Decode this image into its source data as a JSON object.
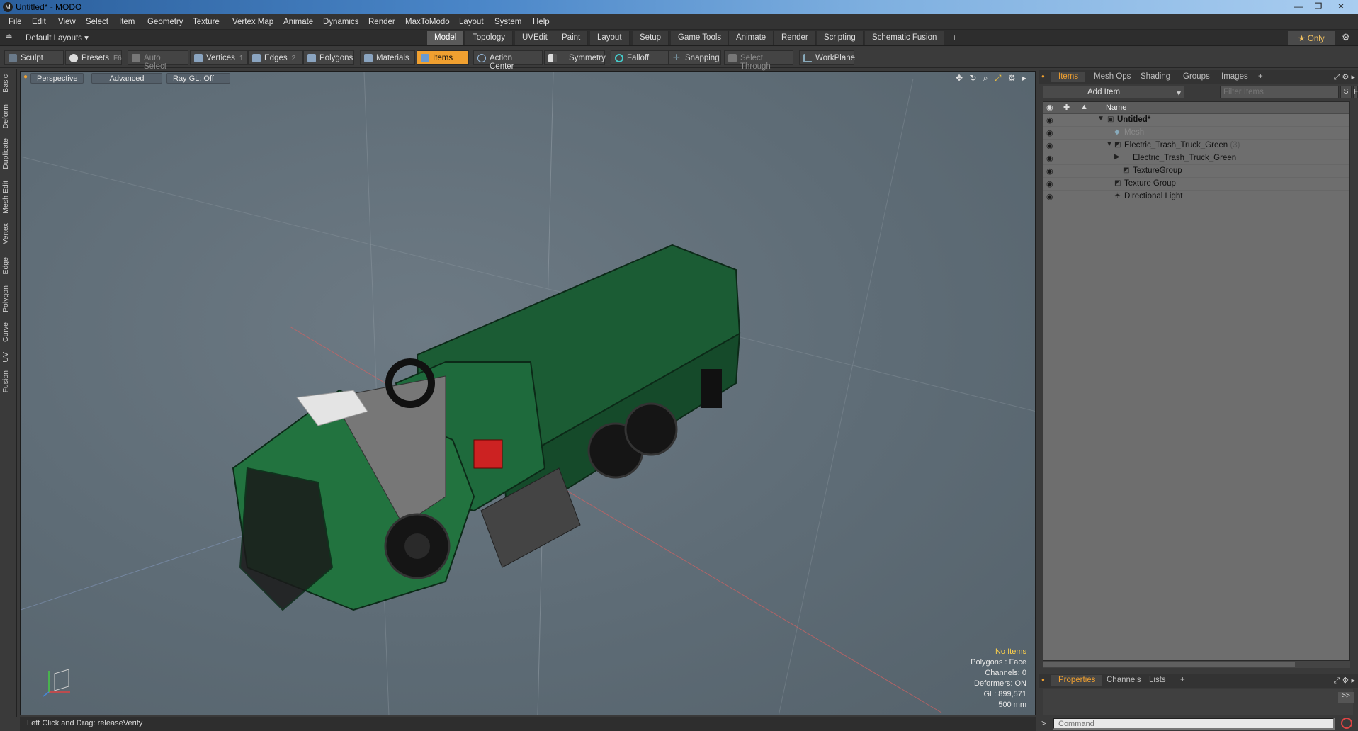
{
  "window": {
    "title": "Untitled* - MODO",
    "app_icon": "modo-logo-icon"
  },
  "menu": [
    "File",
    "Edit",
    "View",
    "Select",
    "Item",
    "Geometry",
    "Texture",
    "Vertex Map",
    "Animate",
    "Dynamics",
    "Render",
    "MaxToModo",
    "Layout",
    "System",
    "Help"
  ],
  "layout": {
    "selector": "Default Layouts ▾",
    "tabs": [
      "Model",
      "Topology",
      "UVEdit",
      "Paint",
      "Layout",
      "Setup",
      "Game Tools",
      "Animate",
      "Render",
      "Scripting",
      "Schematic Fusion",
      "+"
    ],
    "active_tab": "Model",
    "only_label": "★ Only"
  },
  "toolbar": {
    "sculpt": "Sculpt",
    "presets": "Presets",
    "presets_hotkey": "F6",
    "auto_select": "Auto Select",
    "vertices": "Vertices",
    "vertices_hotkey": "1",
    "edges": "Edges",
    "edges_hotkey": "2",
    "polygons": "Polygons",
    "materials": "Materials",
    "items": "Items",
    "action_center": "Action Center",
    "symmetry": "Symmetry",
    "falloff": "Falloff",
    "snapping": "Snapping",
    "select_through": "Select Through",
    "workplane": "WorkPlane"
  },
  "left_tabs": [
    "Basic",
    "Deform",
    "Duplicate",
    "Mesh Edit",
    "Vertex",
    "Edge",
    "Polygon",
    "Curve",
    "UV",
    "Fusion"
  ],
  "viewport": {
    "view": "Perspective",
    "shading": "Advanced",
    "raygl": "Ray GL: Off",
    "info": {
      "selection": "No Items",
      "polygons": "Polygons : Face",
      "channels": "Channels: 0",
      "deformers": "Deformers: ON",
      "gl": "GL: 899,571",
      "grid": "500 mm"
    }
  },
  "status": {
    "text": "Left Click and Drag:   releaseVerify"
  },
  "right_panel": {
    "tabs": [
      "Items",
      "Mesh Ops",
      "Shading",
      "Groups",
      "Images",
      "+"
    ],
    "active_tab": "Items",
    "add_item": "Add Item",
    "filter_placeholder": "Filter Items",
    "s_btn": "S",
    "f_btn": "F",
    "name_header": "Name",
    "tree": [
      {
        "label": "Untitled*",
        "bold": true,
        "dim": false
      },
      {
        "label": "Mesh",
        "bold": false,
        "dim": true
      },
      {
        "label": "Electric_Trash_Truck_Green",
        "count": "(3)",
        "bold": false,
        "dim": false
      },
      {
        "label": "Electric_Trash_Truck_Green",
        "bold": false,
        "dim": false
      },
      {
        "label": "TextureGroup",
        "bold": false,
        "dim": false
      },
      {
        "label": "Texture Group",
        "bold": false,
        "dim": false
      },
      {
        "label": "Directional Light",
        "bold": false,
        "dim": false
      }
    ],
    "bottom_tabs": [
      "Properties",
      "Channels",
      "Lists",
      "+"
    ],
    "bottom_active": "Properties",
    "expand_label": ">>",
    "command_prompt": ">",
    "command_placeholder": "Command"
  },
  "colors": {
    "accent": "#f0a030",
    "truck_green": "#1f6a3a",
    "viewport_bg": "#5e6c76"
  }
}
